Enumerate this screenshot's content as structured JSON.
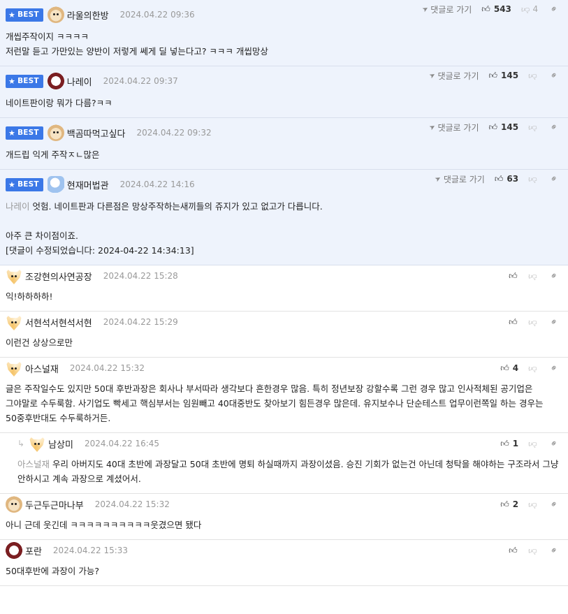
{
  "ui": {
    "best_label": "BEST",
    "goto_label": "댓글로 가기",
    "colors": {
      "best_bg": "#eef3fc",
      "badge": "#3b78e7",
      "mention": "#999999"
    }
  },
  "comments": [
    {
      "best": true,
      "avatar": "dog",
      "nick": "라울의한방",
      "date": "2024.04.22 09:36",
      "up": "543",
      "down": "4",
      "lines": [
        "개씹주작이지 ㅋㅋㅋㅋ",
        "저런말 듣고 가만있는 양반이 저렇게 쎄게 딜 넣는다고? ㅋㅋㅋ 개씹망상"
      ]
    },
    {
      "best": true,
      "avatar": "pup",
      "nick": "나레이",
      "date": "2024.04.22 09:37",
      "up": "145",
      "down": "",
      "lines": [
        "네이트판이랑 뭐가 다름?ㅋㅋ"
      ]
    },
    {
      "best": true,
      "avatar": "dog",
      "nick": "백곰따먹고싶다",
      "date": "2024.04.22 09:32",
      "up": "145",
      "down": "",
      "lines": [
        "개드립 익게 주작ㅈㄴ많은"
      ]
    },
    {
      "best": true,
      "avatar": "ghost",
      "nick": "현재머법관",
      "date": "2024.04.22 14:16",
      "up": "63",
      "down": "",
      "mention": "나레이",
      "lines": [
        "엇험. 네이트판과 다른점은 망상주작하는새끼들의 쥬지가 있고 없고가 다릅니다.",
        "",
        "아주 큰 차이점이죠.",
        "[댓글이 수정되었습니다: 2024-04-22 14:34:13]"
      ]
    },
    {
      "best": false,
      "avatar": "fox",
      "nick": "조강현의사연공장",
      "date": "2024.04.22 15:28",
      "up": "",
      "down": "",
      "lines": [
        "익!하하하하!"
      ]
    },
    {
      "best": false,
      "avatar": "fox",
      "nick": "서현석서현석서현",
      "date": "2024.04.22 15:29",
      "up": "",
      "down": "",
      "lines": [
        "이런건 상상으로만"
      ]
    },
    {
      "best": false,
      "avatar": "fox",
      "nick": "아스널재",
      "date": "2024.04.22 15:32",
      "up": "4",
      "down": "",
      "lines": [
        "글은 주작일수도 있지만 50대 후반과장은 회사나 부서따라 생각보다 흔한경우 많음. 특히 정년보장 강할수록 그런 경우 많고 인사적체된 공기업은 그야말로 수두룩함. 사기업도 빡세고 핵심부서는 임원빼고 40대중반도 찾아보기 힘든경우 많은데. 유지보수나 단순테스트 업무이런쪽일 하는 경우는 50중후반대도 수두룩하거든."
      ]
    },
    {
      "best": false,
      "reply": true,
      "avatar": "fox",
      "nick": "남상미",
      "date": "2024.04.22 16:45",
      "up": "1",
      "down": "",
      "mention": "아스널재",
      "lines": [
        "우리 아버지도 40대 초반에 과장달고 50대 초반에 명퇴 하실때까지 과장이셨음. 승진 기회가 없는건 아닌데 청탁을 해야하는 구조라서 그냥 안하시고 계속 과장으로 계셨어서."
      ]
    },
    {
      "best": false,
      "avatar": "dog",
      "nick": "두근두근마나부",
      "date": "2024.04.22 15:32",
      "up": "2",
      "down": "",
      "lines": [
        "아니 근데 웃긴데 ㅋㅋㅋㅋㅋㅋㅋㅋㅋㅋ웃겼으면 됐다"
      ]
    },
    {
      "best": false,
      "avatar": "pup",
      "nick": "포란",
      "date": "2024.04.22 15:33",
      "up": "",
      "down": "",
      "lines": [
        "50대후반에 과장이 가능?"
      ]
    }
  ]
}
